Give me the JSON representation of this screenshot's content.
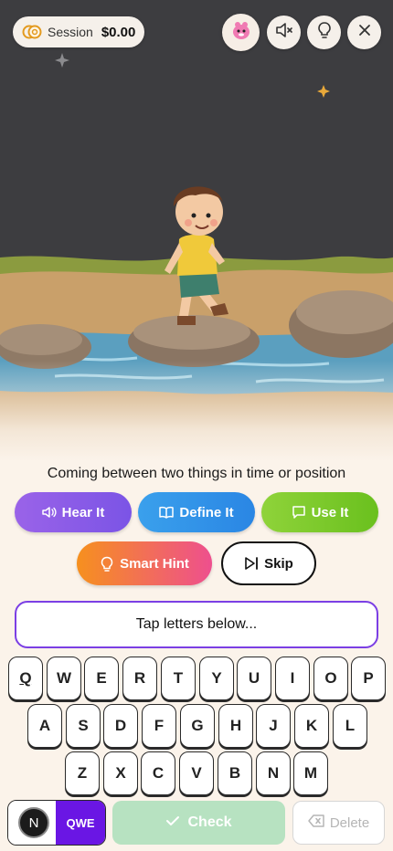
{
  "session": {
    "label": "Session",
    "value": "$0.00",
    "icon": "coins-icon"
  },
  "top_buttons": [
    {
      "name": "mascot-icon"
    },
    {
      "name": "mute-icon"
    },
    {
      "name": "lightbulb-icon"
    },
    {
      "name": "close-icon"
    }
  ],
  "definition": "Coming between two things in time or position",
  "actions": {
    "hear": "Hear It",
    "define": "Define It",
    "use": "Use It",
    "smart_hint": "Smart Hint",
    "skip": "Skip"
  },
  "answer_placeholder": "Tap letters below...",
  "keyboard": {
    "row1": [
      "Q",
      "W",
      "E",
      "R",
      "T",
      "Y",
      "U",
      "I",
      "O",
      "P"
    ],
    "row2": [
      "A",
      "S",
      "D",
      "F",
      "G",
      "H",
      "J",
      "K",
      "L"
    ],
    "row3": [
      "Z",
      "X",
      "C",
      "V",
      "B",
      "N",
      "M"
    ]
  },
  "bottom": {
    "badge": "N",
    "layout_label": "QWE",
    "check": "Check",
    "delete": "Delete"
  },
  "colors": {
    "accent_purple": "#6a16e4",
    "hear": "#8a5ce8",
    "define": "#3296ea",
    "use": "#7cc92c",
    "check_disabled": "#b7e2c1"
  }
}
